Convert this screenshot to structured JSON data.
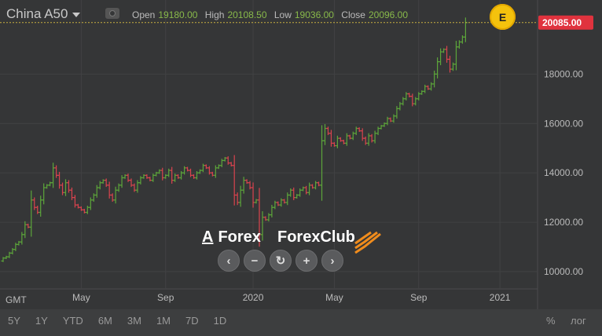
{
  "symbol": {
    "name": "China A50",
    "caret_icon": "chevron-down-icon",
    "visibility_icon": "eye-icon"
  },
  "ohlc": {
    "open_label": "Open",
    "open": "19180.00",
    "high_label": "High",
    "high": "20108.50",
    "low_label": "Low",
    "low": "19036.00",
    "close_label": "Close",
    "close": "20096.00"
  },
  "event_badge": "E",
  "current_price": "20085.00",
  "colors": {
    "up": "#5ca53a",
    "down": "#d9434e",
    "price_tag": "#e0333e",
    "badge": "#f4c20d",
    "bg": "#353637"
  },
  "timezone": "GMT",
  "branding": {
    "left_logo": "Forex",
    "left_logo_mark": "A",
    "right_logo": "ForexClub"
  },
  "nav_controls": [
    {
      "name": "scroll-left-button",
      "glyph": "‹"
    },
    {
      "name": "zoom-out-button",
      "glyph": "−"
    },
    {
      "name": "reset-button",
      "glyph": "↻"
    },
    {
      "name": "zoom-in-button",
      "glyph": "+"
    },
    {
      "name": "scroll-right-button",
      "glyph": "›"
    }
  ],
  "ranges": [
    "5Y",
    "1Y",
    "YTD",
    "6M",
    "3M",
    "1M",
    "7D",
    "1D"
  ],
  "scale_options": {
    "percent": "%",
    "log": "лог"
  },
  "chart_data": {
    "type": "ohlc",
    "title": "China A50",
    "y_ticks": [
      "10000.00",
      "12000.00",
      "14000.00",
      "16000.00",
      "18000.00"
    ],
    "y_tick_values": [
      10000,
      12000,
      14000,
      16000,
      18000
    ],
    "ylim": [
      9300,
      21000
    ],
    "x_ticks": [
      "May",
      "Sep",
      "2020",
      "May",
      "Sep",
      "2021"
    ],
    "x_tick_index": [
      25,
      52,
      80,
      106,
      133,
      159
    ],
    "bar_count": 165,
    "grid": true,
    "current_price": 20085,
    "series": [
      {
        "name": "China A50",
        "close": [
          10550,
          10600,
          10750,
          10900,
          11100,
          11200,
          11500,
          11900,
          11800,
          12900,
          12600,
          12400,
          12900,
          13400,
          13500,
          13600,
          14200,
          13900,
          13500,
          13200,
          13600,
          13300,
          13000,
          12700,
          12600,
          12500,
          12400,
          12600,
          12900,
          13100,
          13400,
          13600,
          13700,
          13500,
          13100,
          12900,
          13300,
          13500,
          13800,
          13900,
          13700,
          13500,
          13300,
          13600,
          13800,
          13900,
          13800,
          13700,
          13900,
          14000,
          14100,
          13800,
          13900,
          14100,
          13700,
          13900,
          13800,
          14000,
          14200,
          14100,
          13900,
          13800,
          14000,
          14100,
          14300,
          14200,
          14000,
          13900,
          14200,
          14300,
          14500,
          14600,
          14400,
          14300,
          13100,
          12800,
          13300,
          13700,
          13600,
          13400,
          12800,
          12900,
          11500,
          12200,
          12100,
          12300,
          12600,
          12800,
          12700,
          12900,
          12800,
          13100,
          13300,
          13000,
          13100,
          13300,
          13400,
          13200,
          13500,
          13400,
          13600,
          13500,
          15300,
          15800,
          15600,
          15200,
          15100,
          15400,
          15300,
          15200,
          15500,
          15400,
          15600,
          15800,
          15700,
          15400,
          15200,
          15500,
          15300,
          15600,
          15800,
          15900,
          16000,
          16200,
          16100,
          16300,
          16600,
          16800,
          17000,
          17200,
          17100,
          16800,
          17000,
          17200,
          17300,
          17500,
          17400,
          17600,
          18000,
          18500,
          18900,
          19000,
          18600,
          18200,
          18400,
          19100,
          19300,
          19500,
          20085
        ]
      }
    ]
  }
}
